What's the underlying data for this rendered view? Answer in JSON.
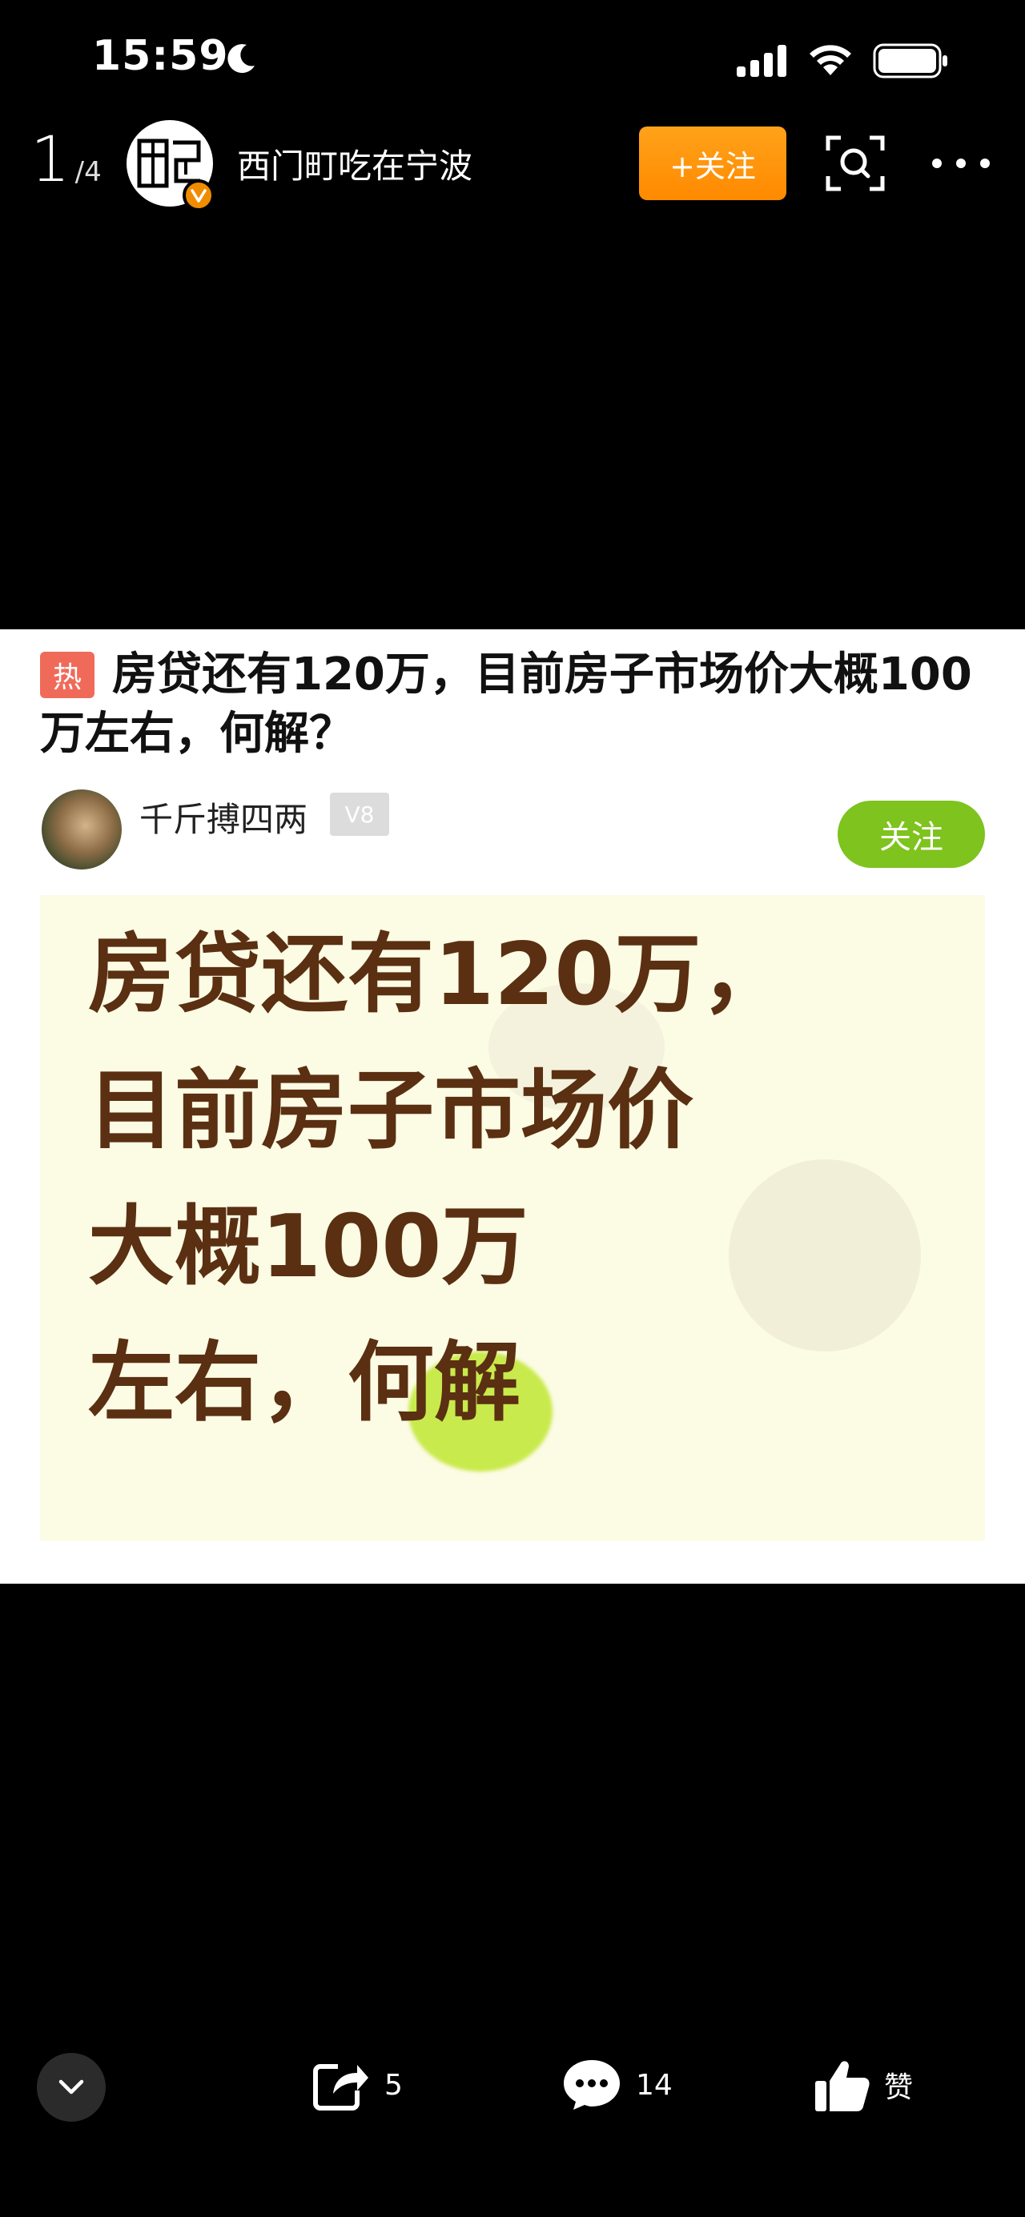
{
  "status_bar": {
    "time": "15:59"
  },
  "top_nav": {
    "page_current": "1",
    "page_separator": "/",
    "page_total": "4",
    "author_name": "西门町吃在宁波",
    "follow_label": "+关注",
    "icons": [
      "moon-icon",
      "signal-icon",
      "wifi-icon",
      "battery-icon",
      "verified-icon",
      "scan-icon",
      "more-icon"
    ]
  },
  "post": {
    "hot_badge": "热",
    "title": "房贷还有120万，目前房子市场价大概100万左右，何解？",
    "poster": {
      "name": "千斤搏四两",
      "level": "V8",
      "follow_label": "关注"
    },
    "image_lines": [
      "房贷还有120万，",
      "目前房子市场价",
      "大概100万",
      "左右，何解"
    ]
  },
  "bottom_bar": {
    "share_count": "5",
    "comment_count": "14",
    "like_label": "赞"
  },
  "colors": {
    "follow_orange": "#ff8a00",
    "follow_green": "#7ec31e",
    "hot_red": "#f06a5a",
    "image_text_brown": "#5a2f12",
    "image_background": "#fcfbe4"
  }
}
